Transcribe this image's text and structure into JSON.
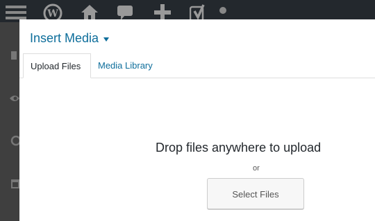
{
  "admin_bar": {
    "icons": [
      "menu-icon",
      "wordpress-logo-icon",
      "home-icon",
      "comment-icon",
      "plus-icon",
      "yoast-icon",
      "notification-dot-icon"
    ]
  },
  "sidebar_icons": [
    "eye-icon",
    "history-icon",
    "calendar-icon"
  ],
  "modal": {
    "title": "Insert Media",
    "tabs": [
      {
        "label": "Upload Files",
        "active": true
      },
      {
        "label": "Media Library",
        "active": false
      }
    ],
    "upload": {
      "instruction": "Drop files anywhere to upload",
      "or_text": "or",
      "select_button": "Select Files"
    }
  },
  "colors": {
    "admin_bar": "#23282d",
    "link_blue": "#0e6e9b",
    "text_dark": "#23282d",
    "button_bg": "#f7f7f7"
  }
}
